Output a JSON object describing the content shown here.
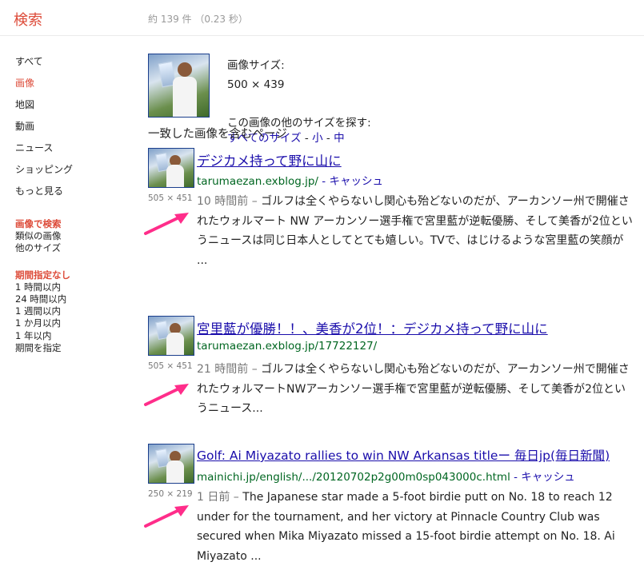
{
  "header": {
    "logo": "検索",
    "stats": "約 139 件 （0.23 秒）"
  },
  "sidebar": {
    "nav": [
      {
        "label": "すべて",
        "active": false
      },
      {
        "label": "画像",
        "active": true
      },
      {
        "label": "地図",
        "active": false
      },
      {
        "label": "動画",
        "active": false
      },
      {
        "label": "ニュース",
        "active": false
      },
      {
        "label": "ショッピング",
        "active": false
      },
      {
        "label": "もっと見る",
        "active": false
      }
    ],
    "image_search": {
      "heading": "画像で検索",
      "links": [
        "類似の画像",
        "他のサイズ"
      ]
    },
    "time_filter": {
      "selected": "期間指定なし",
      "links": [
        "1 時間以内",
        "24 時間以内",
        "1 週間以内",
        "1 か月以内",
        "1 年以内",
        "期間を指定"
      ]
    }
  },
  "query_image": {
    "size_label": "画像サイズ:",
    "size_value": "500 × 439",
    "other_sizes_label": "この画像の他のサイズを探す:",
    "size_links": [
      "すべてのサイズ",
      "小",
      "中"
    ],
    "size_sep": " - "
  },
  "section_heading": "一致した画像を含むページ",
  "results": [
    {
      "title": "デジカメ持って野に山に",
      "url": "tarumaezan.exblog.jp/",
      "cache": " - キャッシュ",
      "dims": "505 × 451",
      "date": "10 時間前 – ",
      "snippet": "ゴルフは全くやらないし関心も殆どないのだが、アーカンソー州で開催されたウォルマート NW アーカンソー選手権で宮里藍が逆転優勝、そして美香が2位というニュースは同じ日本人としてとても嬉しい。TVで、はじけるような宮里藍の笑顔が ..."
    },
    {
      "title": "宮里藍が優勝！！、美香が2位！：デジカメ持って野に山に",
      "url": "tarumaezan.exblog.jp/17722127/",
      "cache": "",
      "dims": "505 × 451",
      "date": "21 時間前 – ",
      "snippet": "ゴルフは全くやらないし関心も殆どないのだが、アーカンソー州で開催されたウォルマートNWアーカンソー選手権で宮里藍が逆転優勝、そして美香が2位というニュース..."
    },
    {
      "title": "Golf: Ai Miyazato rallies to win NW Arkansas titleー 毎日jp(毎日新聞)",
      "url": "mainichi.jp/english/.../20120702p2g00m0sp043000c.html",
      "cache": " - キャッシュ",
      "dims": "250 × 219",
      "date": "1 日前 – ",
      "snippet": "The Japanese star made a 5-foot birdie putt on No. 18 to reach 12 under for the tournament, and her victory at Pinnacle Country Club was secured when Mika Miyazato missed a 15-foot birdie attempt on No. 18. Ai Miyazato ..."
    }
  ],
  "colors": {
    "accent": "#dd4b39",
    "link": "#1a0dab",
    "url": "#006621",
    "arrow": "#ff2d8a"
  }
}
